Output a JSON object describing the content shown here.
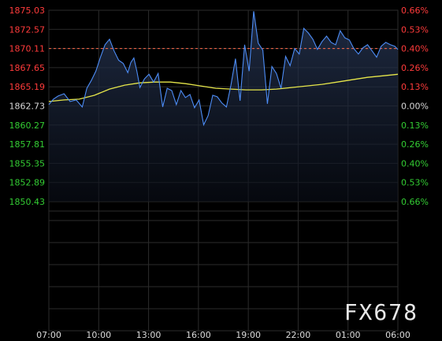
{
  "watermark": "FX678",
  "colors": {
    "background": "#000000",
    "grid": "#2b2b2b",
    "price_up": "#ff3b3b",
    "price_down": "#33cc33",
    "neutral": "#d8d8d8",
    "price_line": "#4d8df7",
    "avg_line": "#e6e64a",
    "ref_line": "#ff6a4a"
  },
  "chart_data": {
    "type": "line",
    "title": "",
    "xlabel": "",
    "ylabel": "",
    "reference_price": 1862.73,
    "last_price": 1870.11,
    "ylim": [
      1850.43,
      1875.03
    ],
    "y_ticks_left": [
      "1875.03",
      "1872.57",
      "1870.11",
      "1867.65",
      "1865.19",
      "1862.73",
      "1860.27",
      "1857.81",
      "1855.35",
      "1852.89",
      "1850.43"
    ],
    "y_ticks_right": [
      "0.66%",
      "0.53%",
      "0.40%",
      "0.26%",
      "0.13%",
      "0.00%",
      "0.13%",
      "0.26%",
      "0.40%",
      "0.53%",
      "0.66%"
    ],
    "x_ticks": [
      "07:00",
      "10:00",
      "13:00",
      "16:00",
      "19:00",
      "22:00",
      "01:00",
      "06:00"
    ],
    "x_range_hours": [
      0,
      23
    ],
    "series": [
      {
        "kind": "price",
        "x": [
          0,
          0.3,
          0.6,
          1.0,
          1.4,
          1.8,
          2.2,
          2.5,
          2.8,
          3.1,
          3.4,
          3.7,
          4.0,
          4.3,
          4.6,
          4.9,
          5.2,
          5.4,
          5.6,
          5.8,
          6.0,
          6.3,
          6.6,
          6.9,
          7.2,
          7.5,
          7.8,
          8.1,
          8.4,
          8.7,
          9.0,
          9.3,
          9.6,
          9.9,
          10.2,
          10.5,
          10.8,
          11.1,
          11.4,
          11.7,
          12.0,
          12.3,
          12.6,
          12.9,
          13.2,
          13.5,
          13.8,
          14.1,
          14.4,
          14.7,
          15.0,
          15.3,
          15.6,
          15.9,
          16.2,
          16.5,
          16.8,
          17.1,
          17.4,
          17.7,
          18.0,
          18.3,
          18.6,
          18.9,
          19.2,
          19.5,
          19.8,
          20.1,
          20.4,
          20.7,
          21.0,
          21.3,
          21.6,
          21.9,
          22.2,
          22.5,
          22.8,
          23.0
        ],
        "y": [
          1862.9,
          1863.6,
          1864.0,
          1864.3,
          1863.3,
          1863.5,
          1862.6,
          1865.0,
          1866.0,
          1867.2,
          1869.0,
          1870.6,
          1871.3,
          1869.8,
          1868.6,
          1868.2,
          1867.0,
          1868.3,
          1868.9,
          1867.2,
          1865.1,
          1866.2,
          1866.8,
          1865.8,
          1866.9,
          1862.6,
          1865.0,
          1864.7,
          1862.9,
          1864.7,
          1863.8,
          1864.2,
          1862.5,
          1863.5,
          1860.3,
          1861.5,
          1864.1,
          1863.9,
          1863.1,
          1862.6,
          1865.4,
          1868.8,
          1863.4,
          1870.6,
          1867.2,
          1874.9,
          1870.8,
          1869.9,
          1863.0,
          1867.8,
          1866.9,
          1865.0,
          1869.1,
          1867.9,
          1870.1,
          1869.4,
          1872.7,
          1872.1,
          1871.3,
          1870.0,
          1871.0,
          1871.7,
          1870.9,
          1870.6,
          1872.4,
          1871.5,
          1871.2,
          1870.1,
          1869.4,
          1870.2,
          1870.6,
          1869.8,
          1869.0,
          1870.4,
          1870.9,
          1870.6,
          1870.4,
          1870.0
        ]
      },
      {
        "kind": "average",
        "x": [
          0,
          1,
          2,
          3,
          4,
          5,
          6,
          7,
          8,
          9,
          10,
          11,
          12,
          13,
          14,
          15,
          16,
          17,
          18,
          19,
          20,
          21,
          22,
          23
        ],
        "y": [
          1863.3,
          1863.5,
          1863.6,
          1864.1,
          1864.9,
          1865.4,
          1865.7,
          1865.8,
          1865.8,
          1865.6,
          1865.3,
          1865.0,
          1864.9,
          1864.8,
          1864.8,
          1864.9,
          1865.1,
          1865.3,
          1865.5,
          1865.8,
          1866.1,
          1866.4,
          1866.6,
          1866.8
        ]
      }
    ]
  }
}
